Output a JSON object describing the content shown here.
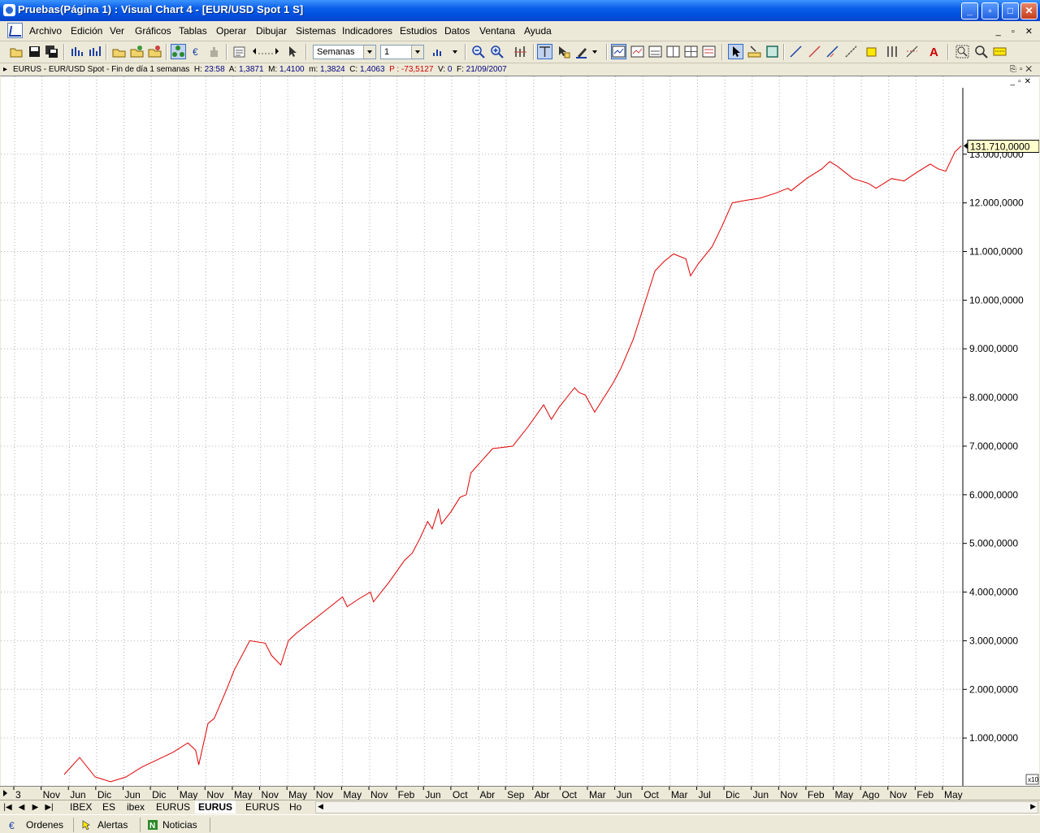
{
  "window": {
    "title": "Pruebas(Página 1) : Visual Chart 4 - [EUR/USD Spot 1 S]"
  },
  "menu": [
    "Archivo",
    "Edición",
    "Ver",
    "Gráficos",
    "Tablas",
    "Operar",
    "Dibujar",
    "Sistemas",
    "Indicadores",
    "Estudios",
    "Datos",
    "Ventana",
    "Ayuda"
  ],
  "toolbar": {
    "period_value": "Semanas",
    "compression_value": "1"
  },
  "infobar": {
    "symbol": "EURUS - EUR/USD Spot - Fin de día 1 semanas",
    "h_label": "H:",
    "h_val": "23:58",
    "a_label": "A:",
    "a_val": "1,3871",
    "m_label": "M:",
    "m_val": "1,4100",
    "mn_label": "m:",
    "mn_val": "1,3824",
    "c_label": "C:",
    "c_val": "1,4063",
    "p_text": "P : -73,5127",
    "v_label": "V:",
    "v_val": "0",
    "f_label": "F:",
    "f_val": "21/09/2007"
  },
  "chart_data": {
    "type": "line",
    "title": "",
    "xlabel": "",
    "ylabel": "",
    "last_value_label": "131.710,0000",
    "y_scale_label": "x10",
    "ylim": [
      0,
      14600000
    ],
    "y_ticks": [
      1000000,
      2000000,
      3000000,
      4000000,
      5000000,
      6000000,
      7000000,
      8000000,
      9000000,
      10000000,
      11000000,
      12000000,
      13000000
    ],
    "y_tick_labels": [
      "1.000,0000",
      "2.000,0000",
      "3.000,0000",
      "4.000,0000",
      "5.000,0000",
      "6.000,0000",
      "7.000,0000",
      "8.000,0000",
      "9.000,0000",
      "10.000,0000",
      "11.000,0000",
      "12.000,0000",
      "13.000,0000"
    ],
    "x_tick_labels": [
      "3",
      "Nov",
      "Jun",
      "Dic",
      "Jun",
      "Dic",
      "May",
      "Nov",
      "May",
      "Nov",
      "May",
      "Nov",
      "May",
      "Nov",
      "Feb",
      "Jun",
      "Oct",
      "Abr",
      "Sep",
      "Abr",
      "Oct",
      "Mar",
      "Jun",
      "Oct",
      "Mar",
      "Jul",
      "Dic",
      "Jun",
      "Nov",
      "Feb",
      "May",
      "Ago",
      "Nov",
      "Feb",
      "May"
    ],
    "grid": true,
    "series": [
      {
        "color": "#e00000",
        "points": [
          [
            0,
            250000
          ],
          [
            1,
            600000
          ],
          [
            2,
            200000
          ],
          [
            3,
            100000
          ],
          [
            4,
            200000
          ],
          [
            5,
            400000
          ],
          [
            6,
            550000
          ],
          [
            7,
            700000
          ],
          [
            8,
            900000
          ],
          [
            8.5,
            750000
          ],
          [
            8.7,
            450000
          ],
          [
            9.3,
            1300000
          ],
          [
            9.7,
            1400000
          ],
          [
            10.5,
            2000000
          ],
          [
            11,
            2400000
          ],
          [
            12,
            3000000
          ],
          [
            13,
            2950000
          ],
          [
            13.4,
            2700000
          ],
          [
            14,
            2500000
          ],
          [
            14.5,
            3000000
          ],
          [
            15,
            3150000
          ],
          [
            16,
            3400000
          ],
          [
            17,
            3650000
          ],
          [
            18,
            3900000
          ],
          [
            18.3,
            3700000
          ],
          [
            19,
            3850000
          ],
          [
            19.8,
            4000000
          ],
          [
            20,
            3800000
          ],
          [
            21,
            4200000
          ],
          [
            22,
            4650000
          ],
          [
            22.5,
            4800000
          ],
          [
            23,
            5100000
          ],
          [
            23.5,
            5450000
          ],
          [
            23.8,
            5300000
          ],
          [
            24.2,
            5700000
          ],
          [
            24.4,
            5400000
          ],
          [
            25,
            5650000
          ],
          [
            25.6,
            5950000
          ],
          [
            26,
            6000000
          ],
          [
            26.3,
            6450000
          ],
          [
            27,
            6700000
          ],
          [
            27.7,
            6950000
          ],
          [
            29,
            7000000
          ],
          [
            30,
            7400000
          ],
          [
            31,
            7850000
          ],
          [
            31.5,
            7550000
          ],
          [
            32,
            7800000
          ],
          [
            33,
            8200000
          ],
          [
            33.3,
            8100000
          ],
          [
            33.7,
            8050000
          ],
          [
            34.3,
            7700000
          ],
          [
            34.8,
            7950000
          ],
          [
            35.5,
            8300000
          ],
          [
            36,
            8600000
          ],
          [
            36.8,
            9200000
          ],
          [
            37.5,
            9900000
          ],
          [
            38.2,
            10600000
          ],
          [
            38.8,
            10800000
          ],
          [
            39.4,
            10950000
          ],
          [
            40.2,
            10850000
          ],
          [
            40.5,
            10500000
          ],
          [
            41,
            10750000
          ],
          [
            41.9,
            11100000
          ],
          [
            42.5,
            11500000
          ],
          [
            43.2,
            12000000
          ],
          [
            44,
            12050000
          ],
          [
            45,
            12100000
          ],
          [
            46,
            12200000
          ],
          [
            46.8,
            12300000
          ],
          [
            47,
            12250000
          ],
          [
            48,
            12500000
          ],
          [
            49,
            12700000
          ],
          [
            49.5,
            12850000
          ],
          [
            50,
            12750000
          ],
          [
            51,
            12500000
          ],
          [
            52,
            12400000
          ],
          [
            52.5,
            12300000
          ],
          [
            53.5,
            12500000
          ],
          [
            54.3,
            12450000
          ],
          [
            55,
            12600000
          ],
          [
            56,
            12800000
          ],
          [
            56.5,
            12700000
          ],
          [
            57,
            12650000
          ],
          [
            57.6,
            13050000
          ],
          [
            58,
            13171000
          ]
        ]
      }
    ]
  },
  "tabs": {
    "first_label": "3",
    "items": [
      "IBEX",
      "ES",
      "ibex",
      "EURUS",
      "EURUS",
      "EURUS",
      "Ho"
    ],
    "active_index": 4
  },
  "statusbar": {
    "orders": "Ordenes",
    "alerts": "Alertas",
    "news": "Noticias"
  },
  "colors": {
    "accent": "#0a5de8",
    "series": "#e00000",
    "grid": "#b0b0b0",
    "last_value_bg": "#ffffcc"
  }
}
